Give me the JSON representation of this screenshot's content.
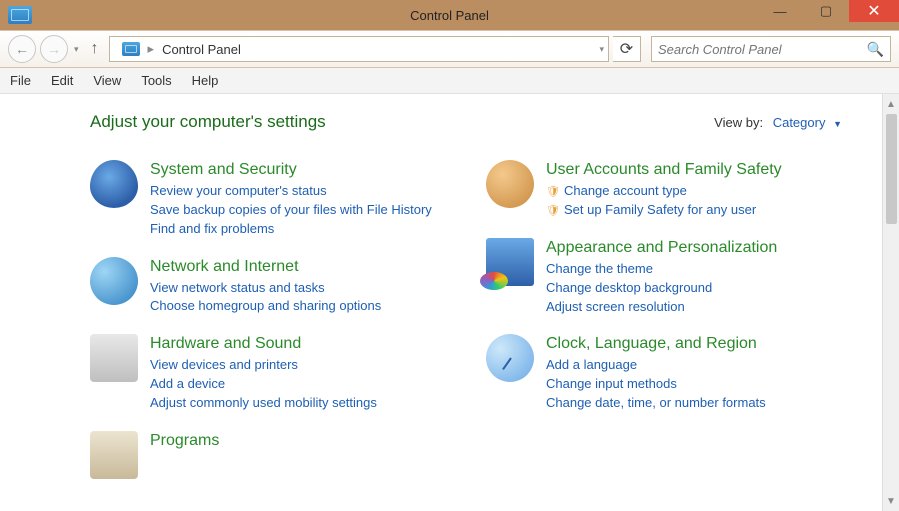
{
  "window": {
    "title": "Control Panel"
  },
  "address": {
    "path": "Control Panel"
  },
  "search": {
    "placeholder": "Search Control Panel"
  },
  "menu": {
    "file": "File",
    "edit": "Edit",
    "view": "View",
    "tools": "Tools",
    "help": "Help"
  },
  "header": {
    "heading": "Adjust your computer's settings",
    "viewby_label": "View by:",
    "viewby_value": "Category"
  },
  "left": [
    {
      "title": "System and Security",
      "links": [
        "Review your computer's status",
        "Save backup copies of your files with File History",
        "Find and fix problems"
      ]
    },
    {
      "title": "Network and Internet",
      "links": [
        "View network status and tasks",
        "Choose homegroup and sharing options"
      ]
    },
    {
      "title": "Hardware and Sound",
      "links": [
        "View devices and printers",
        "Add a device",
        "Adjust commonly used mobility settings"
      ]
    },
    {
      "title": "Programs",
      "links": []
    }
  ],
  "right": [
    {
      "title": "User Accounts and Family Safety",
      "links": [
        "Change account type",
        "Set up Family Safety for any user"
      ],
      "shield": [
        true,
        true
      ]
    },
    {
      "title": "Appearance and Personalization",
      "links": [
        "Change the theme",
        "Change desktop background",
        "Adjust screen resolution"
      ]
    },
    {
      "title": "Clock, Language, and Region",
      "links": [
        "Add a language",
        "Change input methods",
        "Change date, time, or number formats"
      ]
    }
  ]
}
